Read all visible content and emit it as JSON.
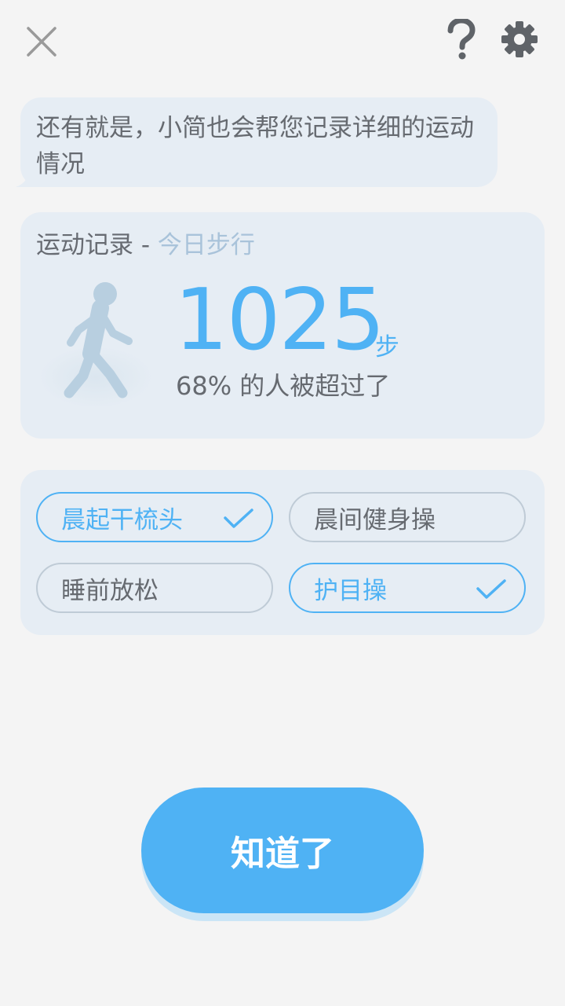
{
  "header": {
    "close_icon": "close-icon",
    "help_icon": "question-icon",
    "settings_icon": "gear-icon"
  },
  "message": {
    "text": "还有就是，小简也会帮您记录详细的运动情况"
  },
  "record": {
    "title": "运动记录 - ",
    "subtitle": "今日步行",
    "steps": "1025",
    "unit": "步",
    "rank_text": "68% 的人被超过了",
    "walker_icon": "walking-person-icon"
  },
  "activities": [
    {
      "label": "晨起干梳头",
      "checked": true
    },
    {
      "label": "晨间健身操",
      "checked": false
    },
    {
      "label": "睡前放松",
      "checked": false
    },
    {
      "label": "护目操",
      "checked": true
    }
  ],
  "confirm": {
    "label": "知道了"
  },
  "colors": {
    "accent": "#4fb2f4",
    "card": "#e6edf4",
    "background": "#f4f4f4"
  }
}
